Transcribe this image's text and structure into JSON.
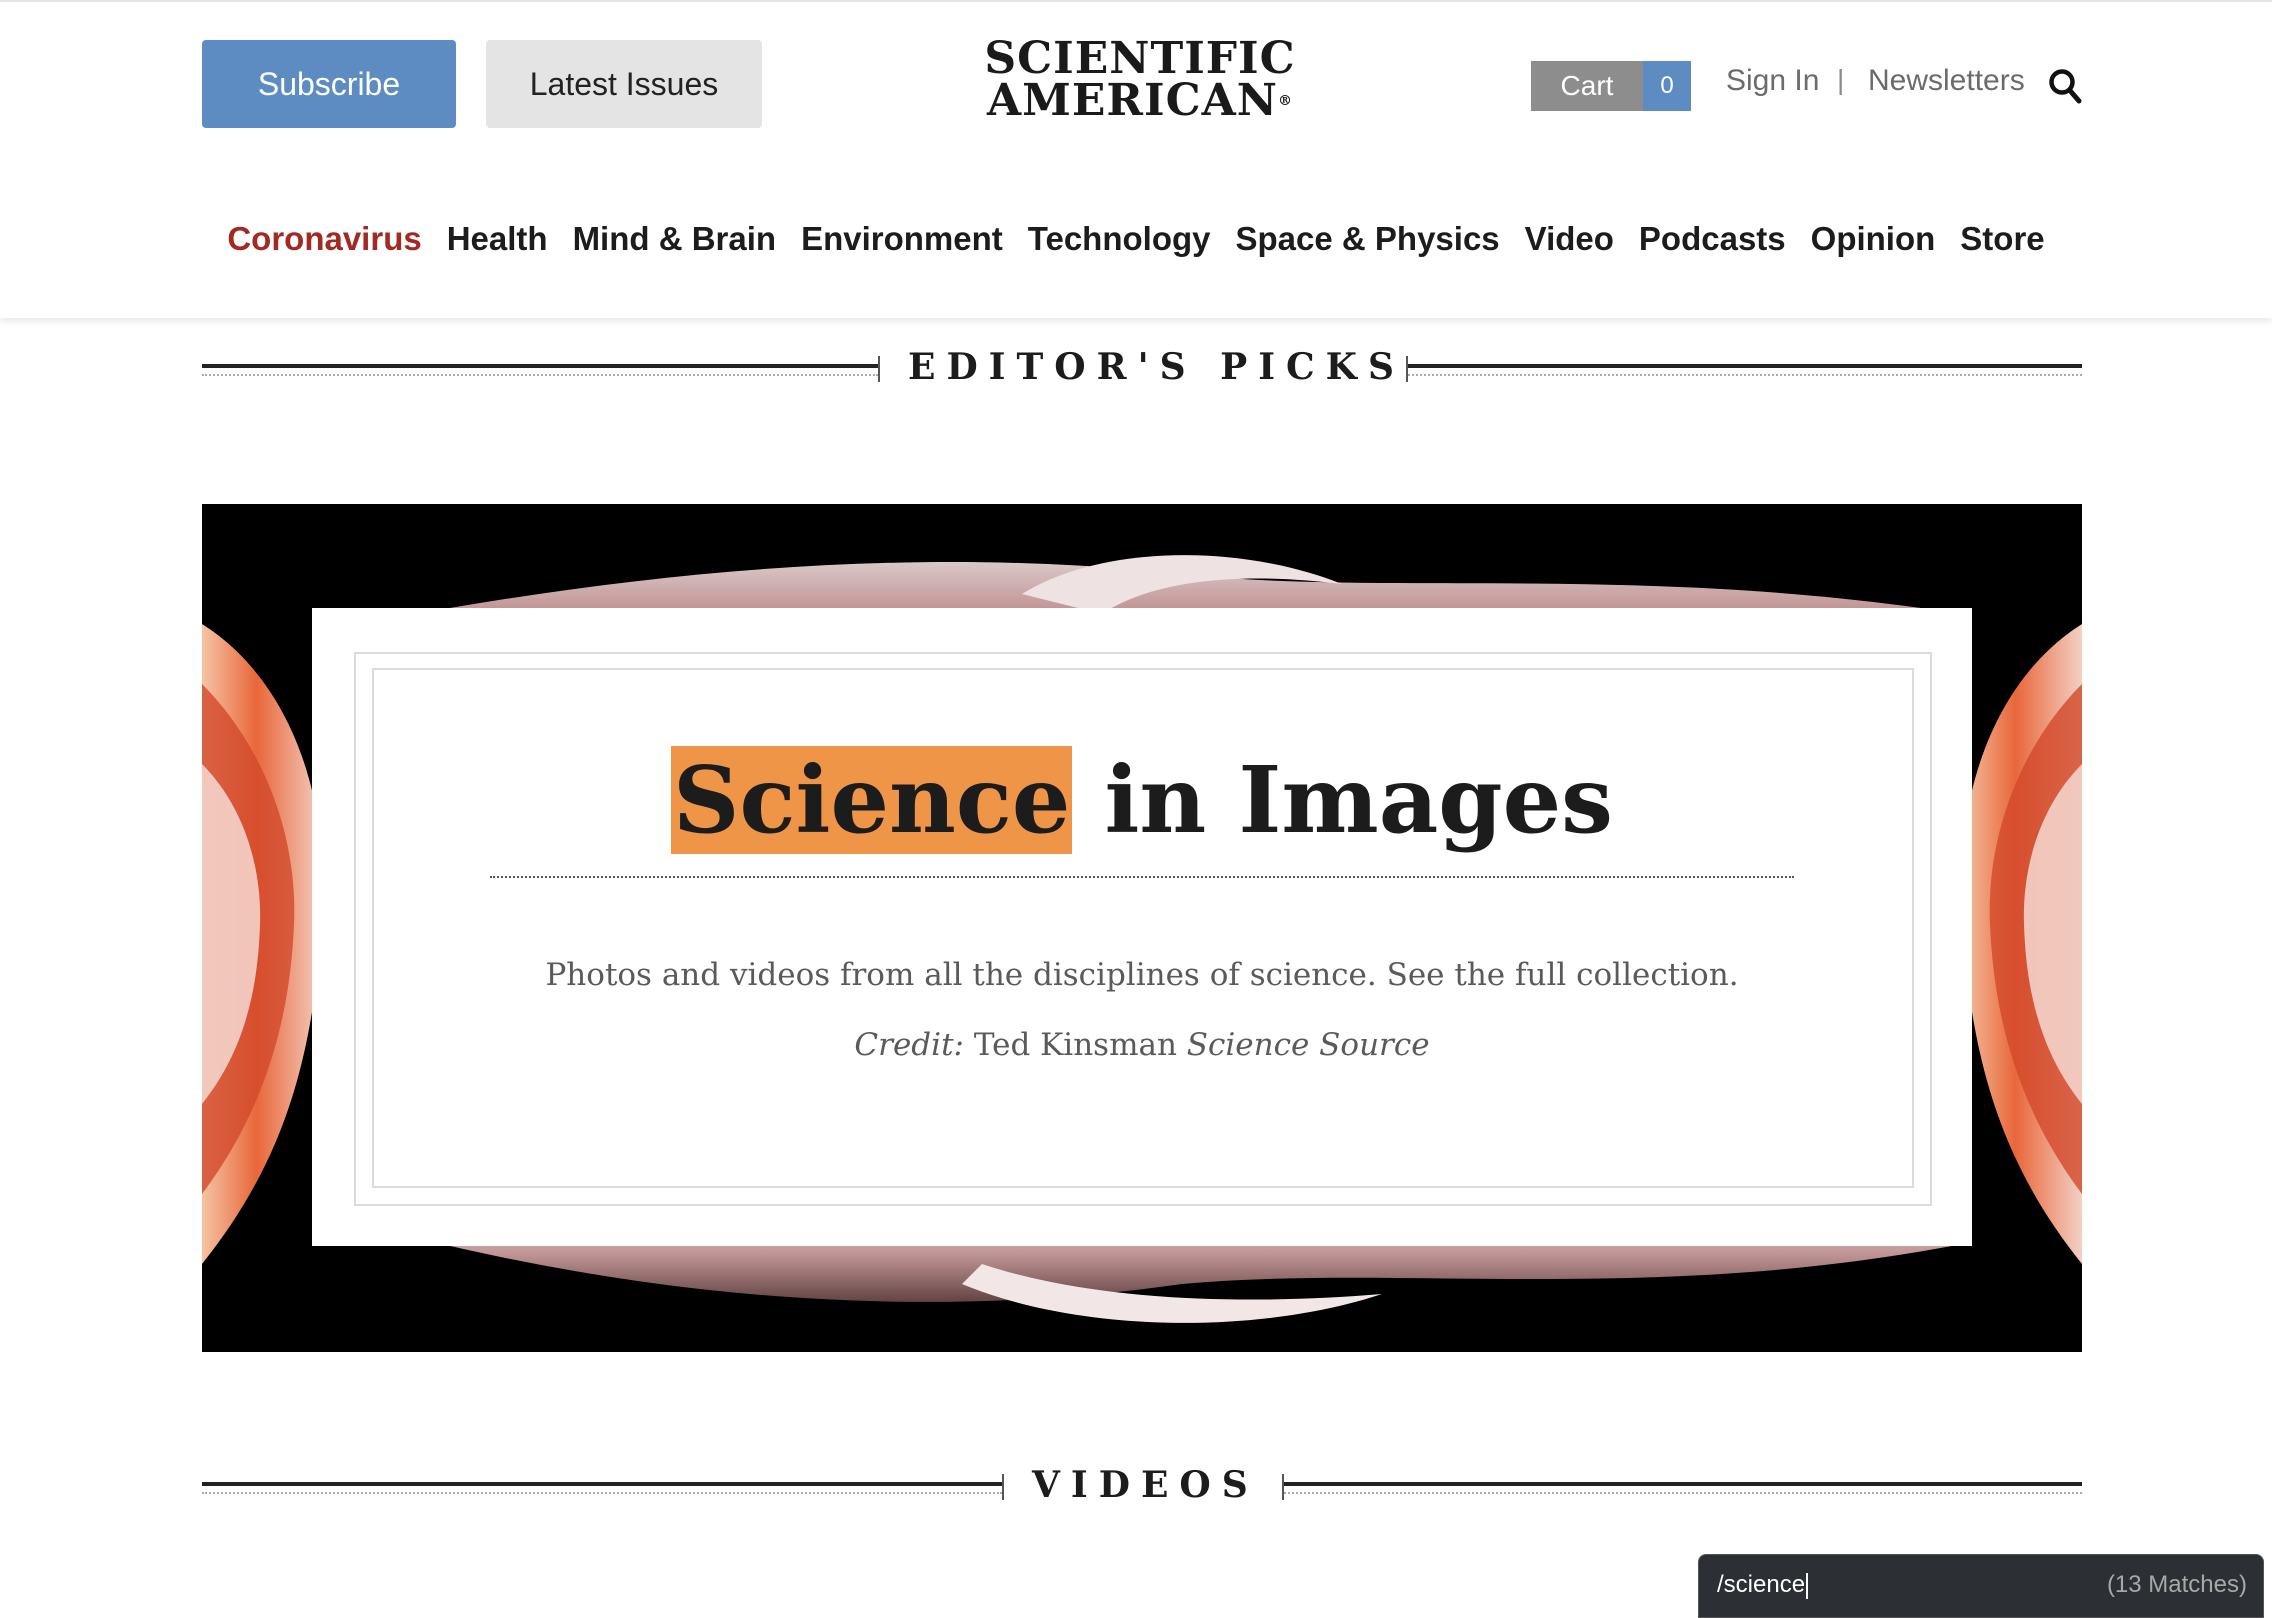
{
  "header": {
    "subscribe_label": "Subscribe",
    "latest_issues_label": "Latest Issues",
    "logo_line1": "SCIENTIFIC",
    "logo_line2": "AMERICAN",
    "logo_mark": "®",
    "cart_label": "Cart",
    "cart_count": "0",
    "signin_label": "Sign In",
    "separator": "|",
    "newsletters_label": "Newsletters",
    "search_icon": "search-icon"
  },
  "nav": {
    "items": [
      {
        "label": "Coronavirus",
        "active": true
      },
      {
        "label": "Health"
      },
      {
        "label": "Mind & Brain"
      },
      {
        "label": "Environment"
      },
      {
        "label": "Technology"
      },
      {
        "label": "Space & Physics"
      },
      {
        "label": "Video"
      },
      {
        "label": "Podcasts"
      },
      {
        "label": "Opinion"
      },
      {
        "label": "Store"
      }
    ]
  },
  "editors_picks": {
    "section_title": "EDITOR'S PICKS",
    "feature": {
      "headline_highlight": "Science",
      "headline_rest": " in Images",
      "description": "Photos and videos from all the disciplines of science. See the full collection. ",
      "credit_label": "Credit:",
      "credit_name": " Ted Kinsman ",
      "credit_source": "Science Source"
    }
  },
  "videos": {
    "section_title": "VIDEOS"
  },
  "find_bar": {
    "query": "/science",
    "matches": "(13 Matches)"
  },
  "colors": {
    "subscribe_bg": "#5d8cc2",
    "active_nav": "#a32a23",
    "highlight": "#ef9547",
    "cart_bg": "#8d8d8d"
  }
}
